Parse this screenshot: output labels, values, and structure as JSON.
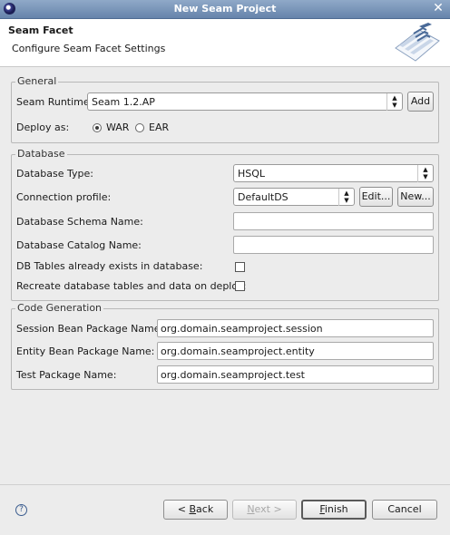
{
  "window": {
    "title": "New Seam Project",
    "close_glyph": "✕"
  },
  "banner": {
    "title": "Seam Facet",
    "description": "Configure Seam Facet Settings"
  },
  "general": {
    "legend": "General",
    "runtime_label": "Seam Runtime",
    "runtime_value": "Seam 1.2.AP",
    "add_label": "Add",
    "deploy_label": "Deploy as:",
    "war_label": "WAR",
    "ear_label": "EAR",
    "deploy_selected": "WAR"
  },
  "database": {
    "legend": "Database",
    "type_label": "Database Type:",
    "type_value": "HSQL",
    "profile_label": "Connection profile:",
    "profile_value": "DefaultDS",
    "edit_label": "Edit...",
    "new_label": "New...",
    "schema_label": "Database Schema Name:",
    "schema_value": "",
    "catalog_label": "Database Catalog Name:",
    "catalog_value": "",
    "tables_exist_label": "DB Tables already exists in database:",
    "tables_exist_checked": false,
    "recreate_label": "Recreate database tables and data on deploy:",
    "recreate_checked": false
  },
  "codegen": {
    "legend": "Code Generation",
    "session_label": "Session Bean Package Name:",
    "session_value": "org.domain.seamproject.session",
    "entity_label": "Entity Bean Package Name:",
    "entity_value": "org.domain.seamproject.entity",
    "test_label": "Test Package Name:",
    "test_value": "org.domain.seamproject.test"
  },
  "footer": {
    "help_glyph": "?",
    "back": {
      "prefix": "< ",
      "mnemonic": "B",
      "rest": "ack"
    },
    "next": {
      "mnemonic": "N",
      "rest": "ext >"
    },
    "finish": {
      "mnemonic": "F",
      "rest": "inish"
    },
    "cancel_label": "Cancel"
  },
  "colors": {
    "titlebar": "#6684ab",
    "dialog_bg": "#ececec",
    "banner_bg": "#ffffff"
  }
}
